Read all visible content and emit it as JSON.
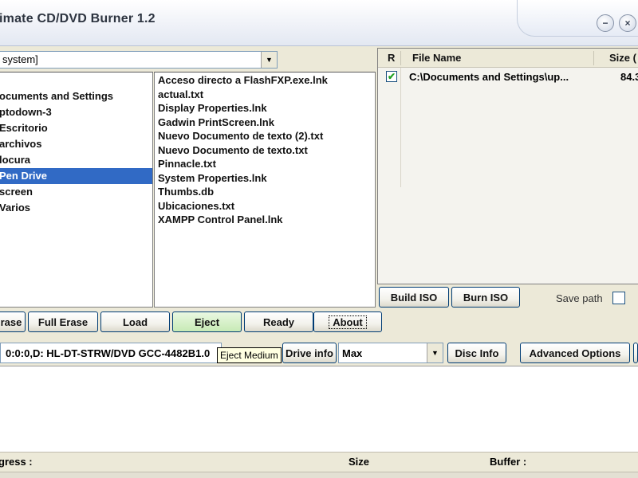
{
  "window": {
    "title": "imate CD/DVD Burner 1.2",
    "minimize_glyph": "−",
    "close_glyph": "×"
  },
  "explorer": {
    "drive_combo_value": "system]",
    "folders": [
      "ocuments and Settings",
      "ptodown-3",
      "Escritorio",
      "archivos",
      "locura",
      "Pen Drive",
      "screen",
      "Varios"
    ],
    "selected_folder_index": 5,
    "files": [
      "Acceso directo a FlashFXP.exe.lnk",
      "actual.txt",
      "Display Properties.lnk",
      "Gadwin PrintScreen.lnk",
      "Nuevo Documento de texto (2).txt",
      "Nuevo Documento de texto.txt",
      "Pinnacle.txt",
      "System Properties.lnk",
      "Thumbs.db",
      "Ubicaciones.txt",
      "XAMPP Control Panel.lnk"
    ]
  },
  "compilation": {
    "headers": {
      "r": "R",
      "file_name": "File Name",
      "size": "Size ("
    },
    "rows": [
      {
        "checked": true,
        "file": "C:\\Documents and Settings\\up...",
        "size": "84.3"
      }
    ],
    "build_iso": "Build ISO",
    "burn_iso": "Burn ISO",
    "save_path_label": "Save path",
    "save_path_checked": false
  },
  "toolbar": {
    "erase": "rase",
    "full_erase": "Full Erase",
    "load": "Load",
    "eject": "Eject",
    "ready": "Ready",
    "about": "About"
  },
  "device": {
    "drive": "0:0:0,D: HL-DT-STRW/DVD GCC-4482B1.0",
    "tooltip": "Eject Medium",
    "drive_info": "Drive info",
    "speed": "Max",
    "disc_info": "Disc Info",
    "advanced_options": "Advanced Options"
  },
  "status": {
    "progress_label": "gress :",
    "size_label": "Size",
    "buffer_label": "Buffer :"
  },
  "colors": {
    "selection": "#316ac5",
    "eject_button": "#c7eab5",
    "tooltip_bg": "#ffffe1"
  }
}
